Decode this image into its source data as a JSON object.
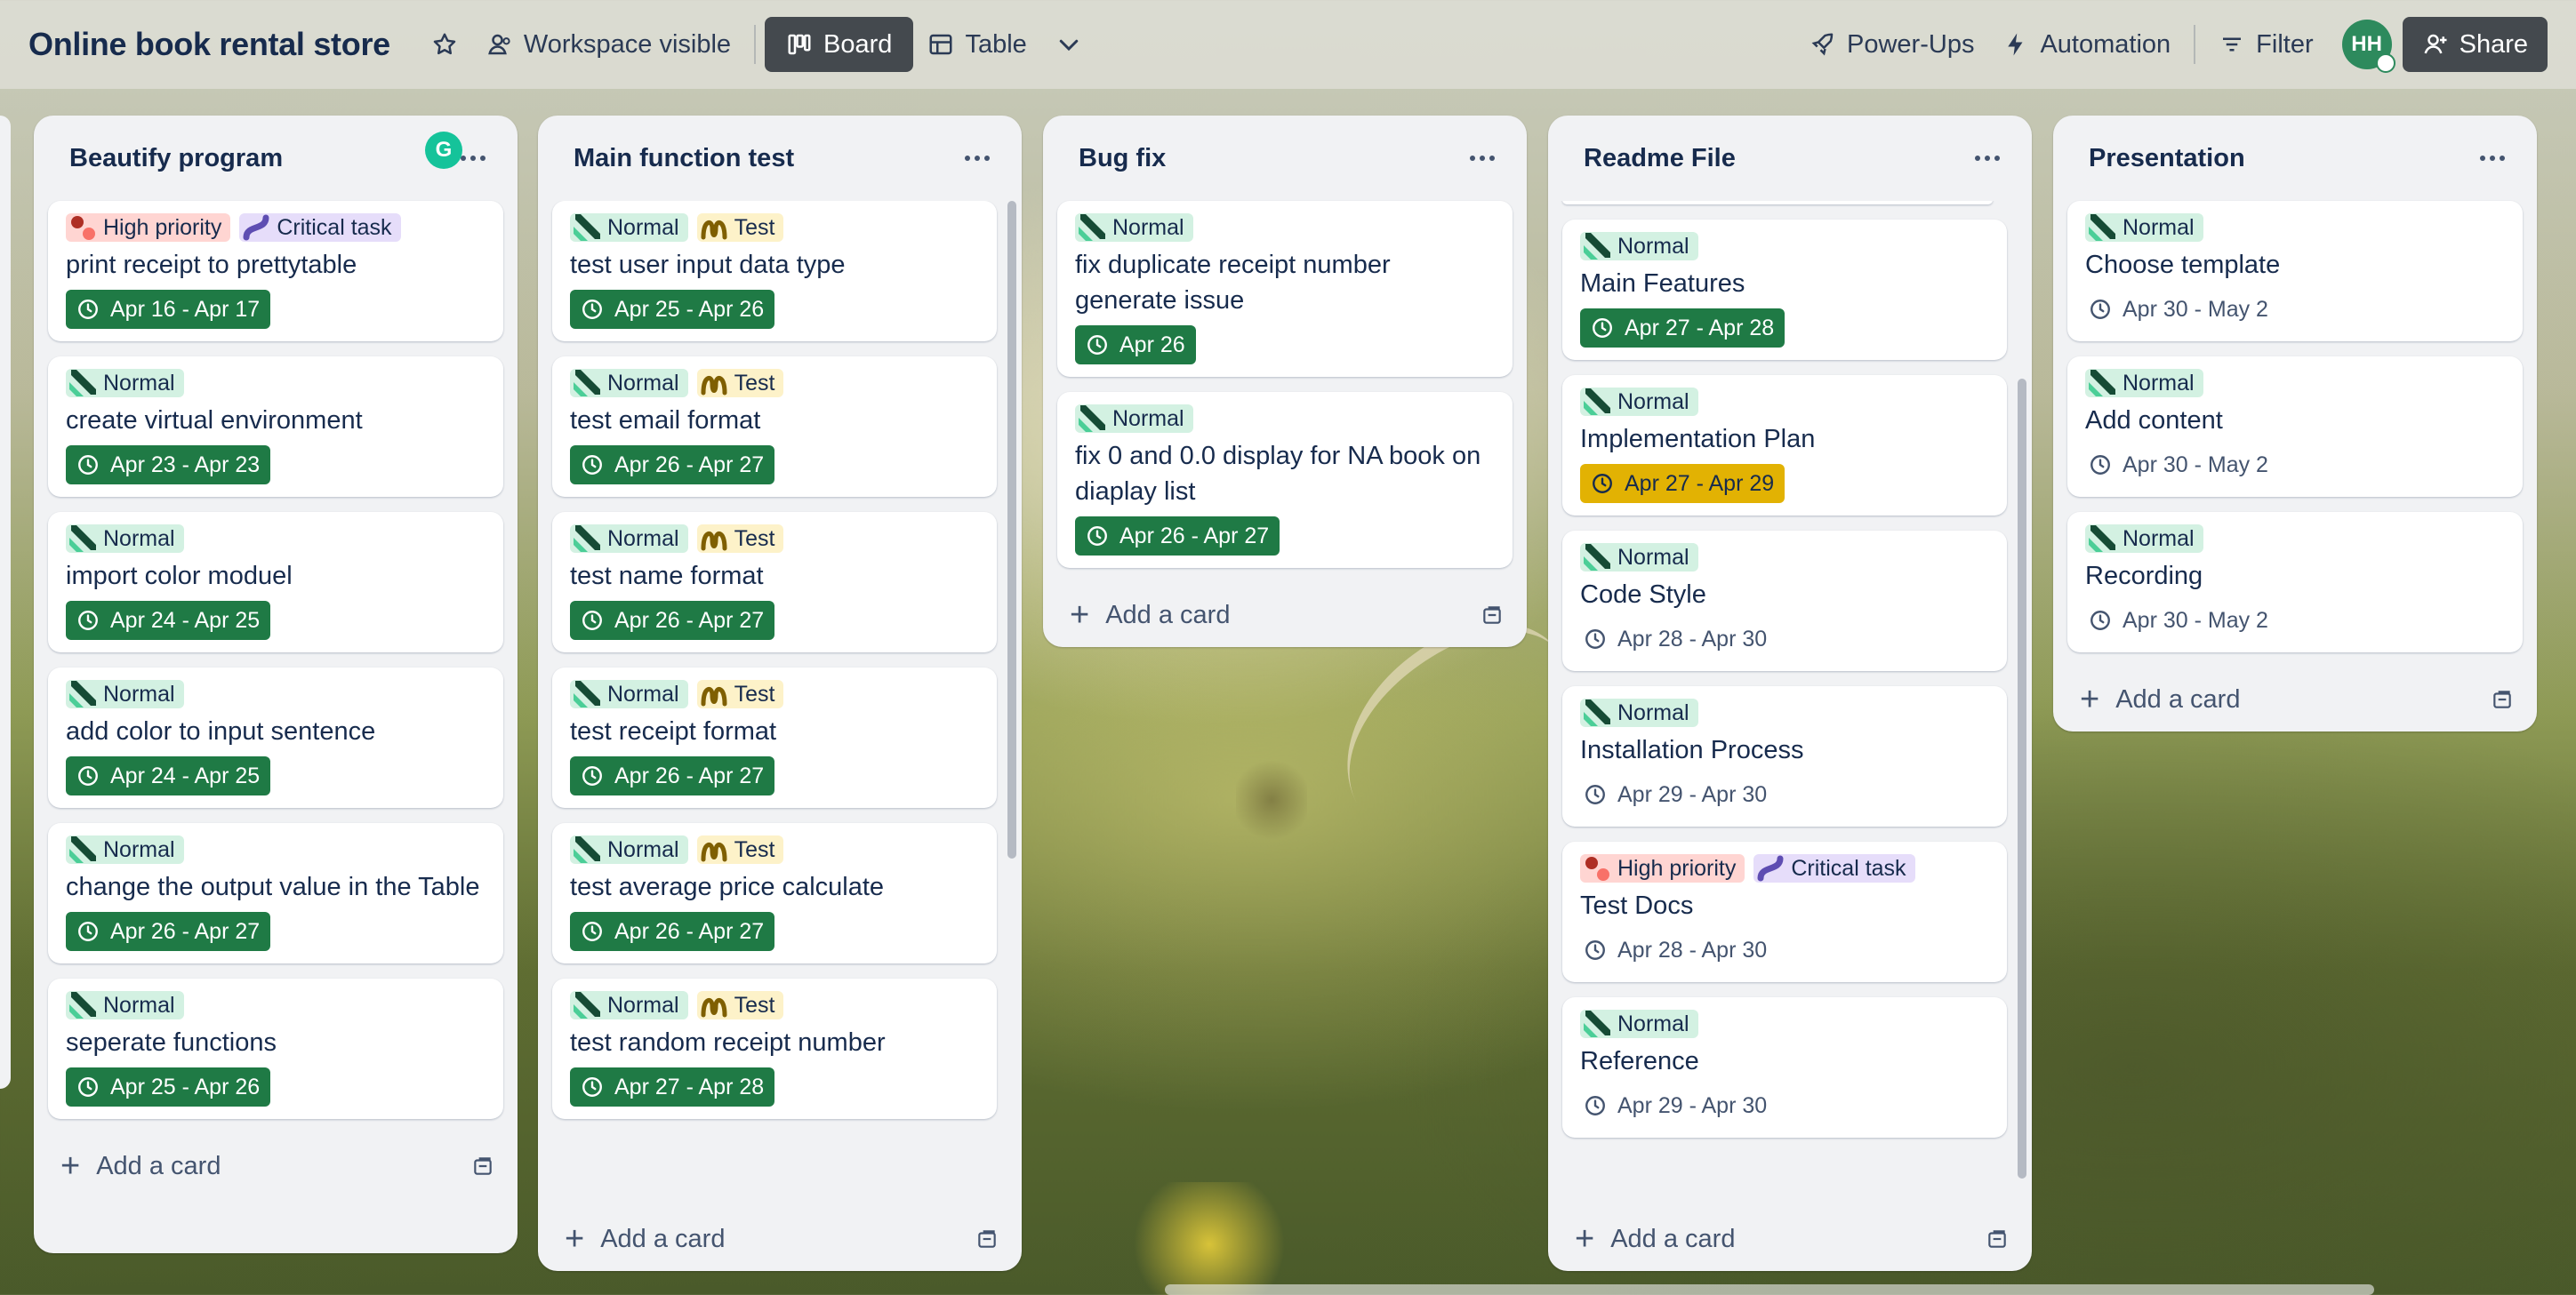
{
  "header": {
    "board_title": "Online book rental store",
    "workspace_visible": "Workspace visible",
    "board": "Board",
    "table": "Table",
    "power_ups": "Power-Ups",
    "automation": "Automation",
    "filter": "Filter",
    "avatar_initials": "HH",
    "share": "Share"
  },
  "colors": {
    "accent_green": "#1f7a45",
    "yellow_date": "#e2b203",
    "header_dark": "#44494e"
  },
  "add_card_label": "Add a card",
  "lists": [
    {
      "title": "Beautify program",
      "cards": [
        {
          "labels": [
            {
              "type": "high",
              "text": "High priority"
            },
            {
              "type": "critical",
              "text": "Critical task"
            }
          ],
          "title": "print receipt to prettytable",
          "date": "Apr 16 - Apr 17",
          "date_style": "green"
        },
        {
          "labels": [
            {
              "type": "normal",
              "text": "Normal"
            }
          ],
          "title": "create virtual environment",
          "date": "Apr 23 - Apr 23",
          "date_style": "green"
        },
        {
          "labels": [
            {
              "type": "normal",
              "text": "Normal"
            }
          ],
          "title": "import color moduel",
          "date": "Apr 24 - Apr 25",
          "date_style": "green"
        },
        {
          "labels": [
            {
              "type": "normal",
              "text": "Normal"
            }
          ],
          "title": "add color to input sentence",
          "date": "Apr 24 - Apr 25",
          "date_style": "green"
        },
        {
          "labels": [
            {
              "type": "normal",
              "text": "Normal"
            }
          ],
          "title": "change the output value in the Table",
          "date": "Apr 26 - Apr 27",
          "date_style": "green"
        },
        {
          "labels": [
            {
              "type": "normal",
              "text": "Normal"
            }
          ],
          "title": "seperate functions",
          "date": "Apr 25 - Apr 26",
          "date_style": "green"
        }
      ]
    },
    {
      "title": "Main function test",
      "cards": [
        {
          "labels": [
            {
              "type": "normal",
              "text": "Normal"
            },
            {
              "type": "test",
              "text": "Test"
            }
          ],
          "title": "test user input data type",
          "date": "Apr 25 - Apr 26",
          "date_style": "green"
        },
        {
          "labels": [
            {
              "type": "normal",
              "text": "Normal"
            },
            {
              "type": "test",
              "text": "Test"
            }
          ],
          "title": "test email format",
          "date": "Apr 26 - Apr 27",
          "date_style": "green"
        },
        {
          "labels": [
            {
              "type": "normal",
              "text": "Normal"
            },
            {
              "type": "test",
              "text": "Test"
            }
          ],
          "title": "test name format",
          "date": "Apr 26 - Apr 27",
          "date_style": "green"
        },
        {
          "labels": [
            {
              "type": "normal",
              "text": "Normal"
            },
            {
              "type": "test",
              "text": "Test"
            }
          ],
          "title": "test receipt format",
          "date": "Apr 26 - Apr 27",
          "date_style": "green"
        },
        {
          "labels": [
            {
              "type": "normal",
              "text": "Normal"
            },
            {
              "type": "test",
              "text": "Test"
            }
          ],
          "title": "test average price calculate",
          "date": "Apr 26 - Apr 27",
          "date_style": "green"
        },
        {
          "labels": [
            {
              "type": "normal",
              "text": "Normal"
            },
            {
              "type": "test",
              "text": "Test"
            }
          ],
          "title": "test random receipt number",
          "date": "Apr 27 - Apr 28",
          "date_style": "green"
        }
      ]
    },
    {
      "title": "Bug fix",
      "cards": [
        {
          "labels": [
            {
              "type": "normal",
              "text": "Normal"
            }
          ],
          "title": "fix duplicate receipt number generate issue",
          "date": "Apr 26",
          "date_style": "green"
        },
        {
          "labels": [
            {
              "type": "normal",
              "text": "Normal"
            }
          ],
          "title": "fix 0 and 0.0 display for NA book on diaplay list",
          "date": "Apr 26 - Apr 27",
          "date_style": "green"
        }
      ]
    },
    {
      "title": "Readme File",
      "cards": [
        {
          "labels": [
            {
              "type": "normal",
              "text": "Normal"
            }
          ],
          "title": "Main Features",
          "date": "Apr 27 - Apr 28",
          "date_style": "green"
        },
        {
          "labels": [
            {
              "type": "normal",
              "text": "Normal"
            }
          ],
          "title": "Implementation Plan",
          "date": "Apr 27 - Apr 29",
          "date_style": "yellow"
        },
        {
          "labels": [
            {
              "type": "normal",
              "text": "Normal"
            }
          ],
          "title": "Code Style",
          "date": "Apr 28 - Apr 30",
          "date_style": "plain"
        },
        {
          "labels": [
            {
              "type": "normal",
              "text": "Normal"
            }
          ],
          "title": "Installation Process",
          "date": "Apr 29 - Apr 30",
          "date_style": "plain"
        },
        {
          "labels": [
            {
              "type": "high",
              "text": "High priority"
            },
            {
              "type": "critical",
              "text": "Critical task"
            }
          ],
          "title": "Test Docs",
          "date": "Apr 28 - Apr 30",
          "date_style": "plain"
        },
        {
          "labels": [
            {
              "type": "normal",
              "text": "Normal"
            }
          ],
          "title": "Reference",
          "date": "Apr 29 - Apr 30",
          "date_style": "plain"
        }
      ]
    },
    {
      "title": "Presentation",
      "cards": [
        {
          "labels": [
            {
              "type": "normal",
              "text": "Normal"
            }
          ],
          "title": "Choose template",
          "date": "Apr 30 - May 2",
          "date_style": "plain"
        },
        {
          "labels": [
            {
              "type": "normal",
              "text": "Normal"
            }
          ],
          "title": "Add content",
          "date": "Apr 30 - May 2",
          "date_style": "plain"
        },
        {
          "labels": [
            {
              "type": "normal",
              "text": "Normal"
            }
          ],
          "title": "Recording",
          "date": "Apr 30 - May 2",
          "date_style": "plain"
        }
      ]
    }
  ]
}
